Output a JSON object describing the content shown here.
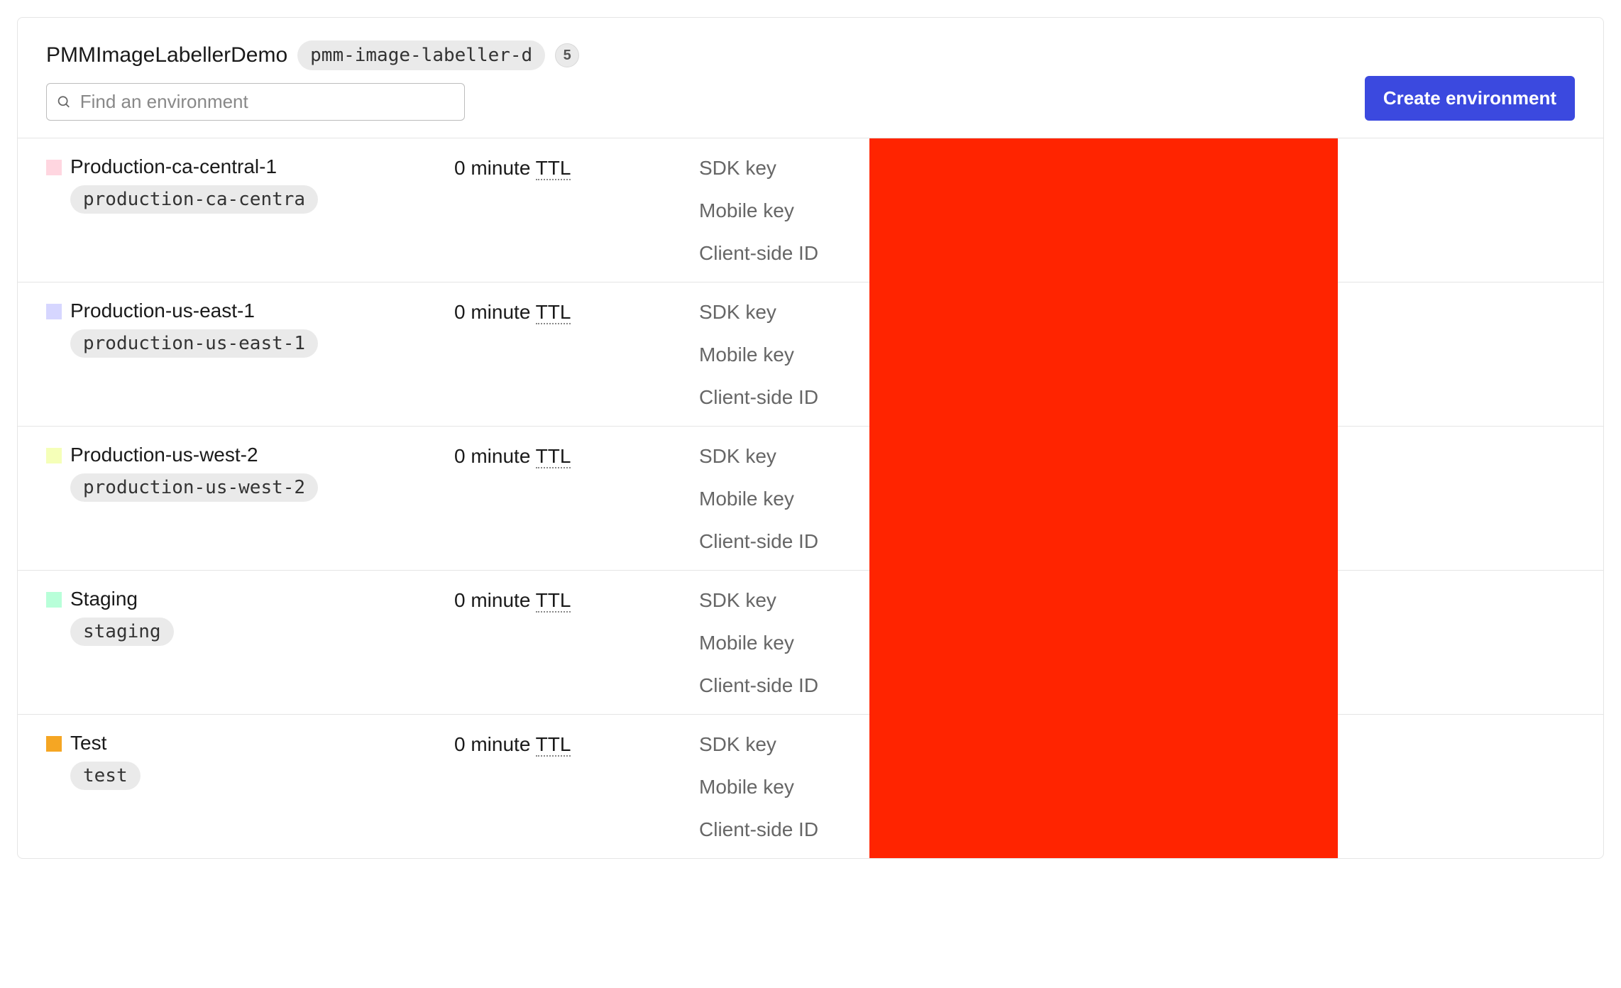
{
  "header": {
    "project_title": "PMMImageLabellerDemo",
    "project_key": "pmm-image-labeller-d",
    "count": "5",
    "search_placeholder": "Find an environment",
    "create_button_label": "Create environment"
  },
  "key_labels": {
    "sdk": "SDK key",
    "mobile": "Mobile key",
    "client": "Client-side ID"
  },
  "ttl_prefix": "0 minute ",
  "ttl_suffix": "TTL",
  "environments": [
    {
      "name": "Production-ca-central-1",
      "key": "production-ca-centra",
      "color": "#ffd6e0"
    },
    {
      "name": "Production-us-east-1",
      "key": "production-us-east-1",
      "color": "#d6d6ff"
    },
    {
      "name": "Production-us-west-2",
      "key": "production-us-west-2",
      "color": "#f5ffb8"
    },
    {
      "name": "Staging",
      "key": "staging",
      "color": "#b8ffd9"
    },
    {
      "name": "Test",
      "key": "test",
      "color": "#f5a623"
    }
  ]
}
